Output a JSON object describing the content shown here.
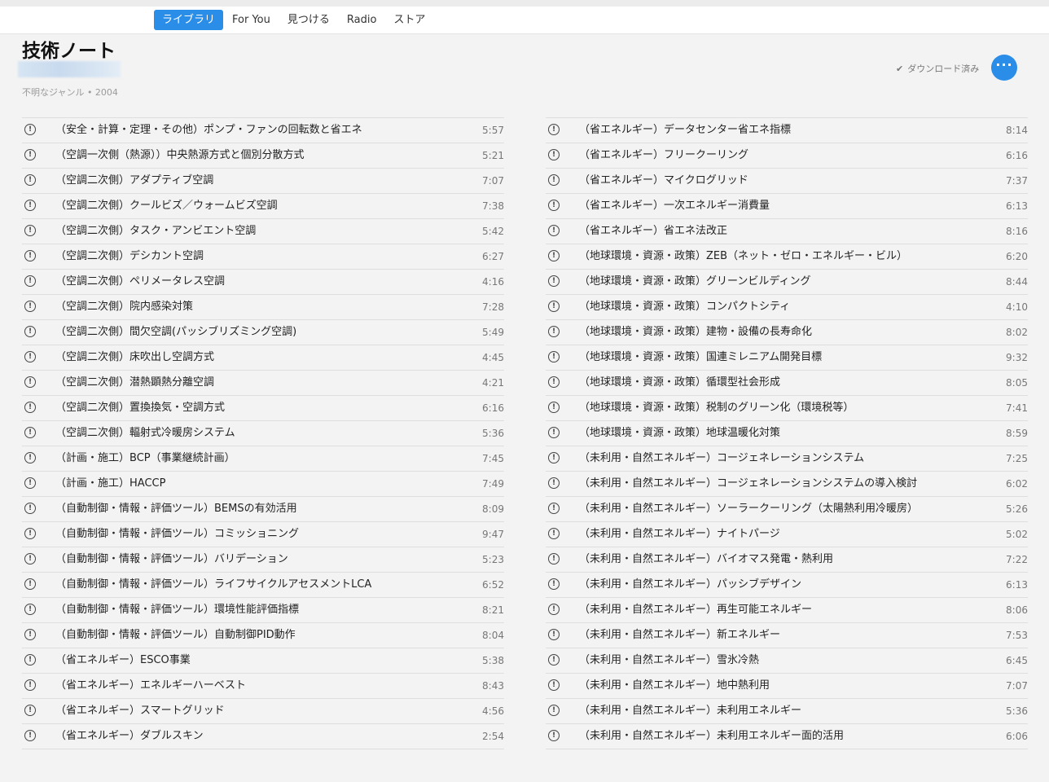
{
  "nav": {
    "tabs": [
      "ライブラリ",
      "For You",
      "見つける",
      "Radio",
      "ストア"
    ],
    "active_tab": "ライブラリ"
  },
  "album": {
    "title": "技術ノート",
    "meta": "不明なジャンル • 2004",
    "download_status": "ダウンロード済み",
    "download_icon": "check-icon",
    "more_icon": "ellipsis-icon"
  },
  "colors": {
    "accent": "#2a8de8",
    "background": "#f3f3f3"
  },
  "left_tracks": [
    {
      "title": "（安全・計算・定理・その他）ポンプ・ファンの回転数と省エネ",
      "duration": "5:57"
    },
    {
      "title": "（空調一次側（熱源））中央熱源方式と個別分散方式",
      "duration": "5:21"
    },
    {
      "title": "（空調二次側）アダプティブ空調",
      "duration": "7:07"
    },
    {
      "title": "（空調二次側）クールビズ／ウォームビズ空調",
      "duration": "7:38"
    },
    {
      "title": "（空調二次側）タスク・アンビエント空調",
      "duration": "5:42"
    },
    {
      "title": "（空調二次側）デシカント空調",
      "duration": "6:27"
    },
    {
      "title": "（空調二次側）ペリメータレス空調",
      "duration": "4:16"
    },
    {
      "title": "（空調二次側）院内感染対策",
      "duration": "7:28"
    },
    {
      "title": "（空調二次側）間欠空調(パッシブリズミング空調)",
      "duration": "5:49"
    },
    {
      "title": "（空調二次側）床吹出し空調方式",
      "duration": "4:45"
    },
    {
      "title": "（空調二次側）潜熱顕熱分離空調",
      "duration": "4:21"
    },
    {
      "title": "（空調二次側）置換換気・空調方式",
      "duration": "6:16"
    },
    {
      "title": "（空調二次側）輻射式冷暖房システム",
      "duration": "5:36"
    },
    {
      "title": "（計画・施工）BCP（事業継続計画）",
      "duration": "7:45"
    },
    {
      "title": "（計画・施工）HACCP",
      "duration": "7:49"
    },
    {
      "title": "（自動制御・情報・評価ツール）BEMSの有効活用",
      "duration": "8:09"
    },
    {
      "title": "（自動制御・情報・評価ツール）コミッショニング",
      "duration": "9:47"
    },
    {
      "title": "（自動制御・情報・評価ツール）バリデーション",
      "duration": "5:23"
    },
    {
      "title": "（自動制御・情報・評価ツール）ライフサイクルアセスメントLCA",
      "duration": "6:52"
    },
    {
      "title": "（自動制御・情報・評価ツール）環境性能評価指標",
      "duration": "8:21"
    },
    {
      "title": "（自動制御・情報・評価ツール）自動制御PID動作",
      "duration": "8:04"
    },
    {
      "title": "（省エネルギー）ESCO事業",
      "duration": "5:38"
    },
    {
      "title": "（省エネルギー）エネルギーハーベスト",
      "duration": "8:43"
    },
    {
      "title": "（省エネルギー）スマートグリッド",
      "duration": "4:56"
    },
    {
      "title": "（省エネルギー）ダブルスキン",
      "duration": "2:54"
    }
  ],
  "right_tracks": [
    {
      "title": "（省エネルギー）データセンター省エネ指標",
      "duration": "8:14"
    },
    {
      "title": "（省エネルギー）フリークーリング",
      "duration": "6:16"
    },
    {
      "title": "（省エネルギー）マイクログリッド",
      "duration": "7:37"
    },
    {
      "title": "（省エネルギー）一次エネルギー消費量",
      "duration": "6:13"
    },
    {
      "title": "（省エネルギー）省エネ法改正",
      "duration": "8:16"
    },
    {
      "title": "（地球環境・資源・政策）ZEB（ネット・ゼロ・エネルギー・ビル）",
      "duration": "6:20"
    },
    {
      "title": "（地球環境・資源・政策）グリーンビルディング",
      "duration": "8:44"
    },
    {
      "title": "（地球環境・資源・政策）コンパクトシティ",
      "duration": "4:10"
    },
    {
      "title": "（地球環境・資源・政策）建物・設備の長寿命化",
      "duration": "8:02"
    },
    {
      "title": "（地球環境・資源・政策）国連ミレニアム開発目標",
      "duration": "9:32"
    },
    {
      "title": "（地球環境・資源・政策）循環型社会形成",
      "duration": "8:05"
    },
    {
      "title": "（地球環境・資源・政策）税制のグリーン化（環境税等）",
      "duration": "7:41"
    },
    {
      "title": "（地球環境・資源・政策）地球温暖化対策",
      "duration": "8:59"
    },
    {
      "title": "（未利用・自然エネルギー）コージェネレーションシステム",
      "duration": "7:25"
    },
    {
      "title": "（未利用・自然エネルギー）コージェネレーションシステムの導入検討",
      "duration": "6:02"
    },
    {
      "title": "（未利用・自然エネルギー）ソーラークーリング（太陽熱利用冷暖房）",
      "duration": "5:26"
    },
    {
      "title": "（未利用・自然エネルギー）ナイトパージ",
      "duration": "5:02"
    },
    {
      "title": "（未利用・自然エネルギー）バイオマス発電・熱利用",
      "duration": "7:22"
    },
    {
      "title": "（未利用・自然エネルギー）パッシブデザイン",
      "duration": "6:13"
    },
    {
      "title": "（未利用・自然エネルギー）再生可能エネルギー",
      "duration": "8:06"
    },
    {
      "title": "（未利用・自然エネルギー）新エネルギー",
      "duration": "7:53"
    },
    {
      "title": "（未利用・自然エネルギー）雪氷冷熱",
      "duration": "6:45"
    },
    {
      "title": "（未利用・自然エネルギー）地中熱利用",
      "duration": "7:07"
    },
    {
      "title": "（未利用・自然エネルギー）未利用エネルギー",
      "duration": "5:36"
    },
    {
      "title": "（未利用・自然エネルギー）未利用エネルギー面的活用",
      "duration": "6:06"
    }
  ]
}
